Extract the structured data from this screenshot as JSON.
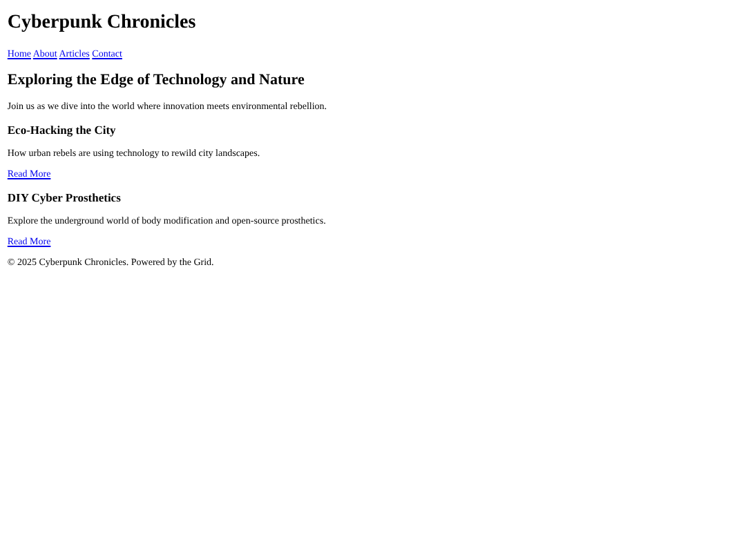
{
  "header": {
    "title": "Cyberpunk Chronicles"
  },
  "nav": [
    {
      "label": "Home"
    },
    {
      "label": "About"
    },
    {
      "label": "Articles"
    },
    {
      "label": "Contact"
    }
  ],
  "intro": {
    "heading": "Exploring the Edge of Technology and Nature",
    "text": "Join us as we dive into the world where innovation meets environmental rebellion."
  },
  "articles": [
    {
      "title": "Eco-Hacking the City",
      "summary": "How urban rebels are using technology to rewild city landscapes.",
      "link": "Read More"
    },
    {
      "title": "DIY Cyber Prosthetics",
      "summary": "Explore the underground world of body modification and open-source prosthetics.",
      "link": "Read More"
    }
  ],
  "footer": {
    "text": "© 2025 Cyberpunk Chronicles. Powered by the Grid."
  }
}
